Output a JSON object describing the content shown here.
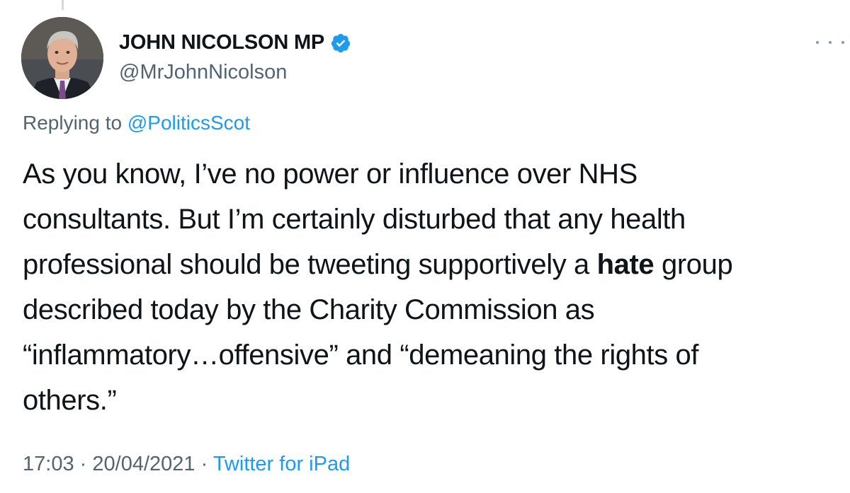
{
  "author": {
    "display_name": "JOHN NICOLSON MP",
    "handle": "@MrJohnNicolson",
    "verified": true,
    "avatar_icon": "profile-photo"
  },
  "reply": {
    "prefix": "Replying to",
    "mention": "@PoliticsScot"
  },
  "tweet": {
    "lines": [
      [
        "As you know, I’ve no power or influence over NHS"
      ],
      [
        "consultants. But I’m certainly disturbed that any health"
      ],
      [
        "professional should be tweeting supportively a ",
        "hate",
        " group"
      ],
      [
        "described today by the Charity Commission as"
      ],
      [
        "“inflammatory…offensive” and “demeaning the rights of"
      ],
      [
        "others.”"
      ]
    ]
  },
  "meta": {
    "time": "17:03",
    "separator": "·",
    "date": "20/04/2021",
    "source": "Twitter for iPad"
  },
  "icons": {
    "verified": "verified-badge-icon",
    "more": "more-options-icon"
  },
  "colors": {
    "link": "#1d9bf0",
    "secondary_text": "#536471",
    "primary_text": "#0f1419"
  }
}
